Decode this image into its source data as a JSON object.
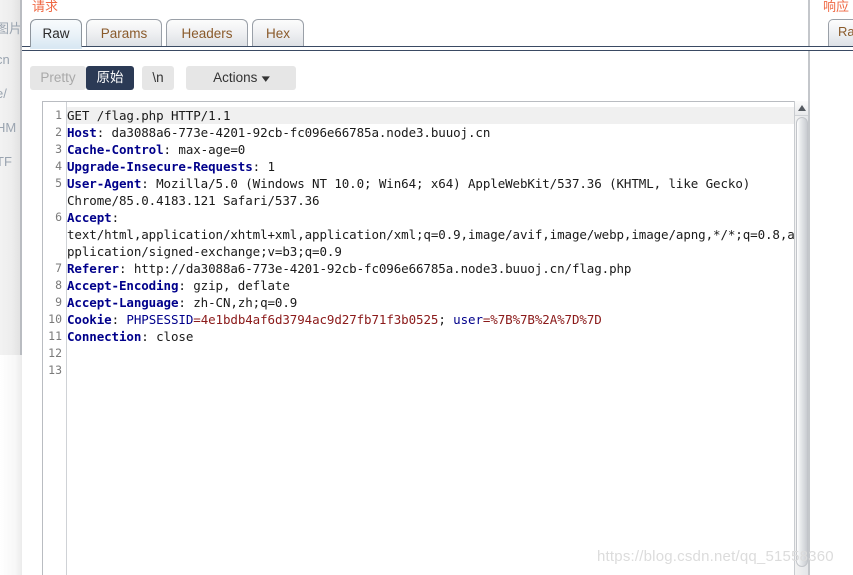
{
  "left_panel": {
    "clipped_text_fragments": [
      "图片",
      "cn",
      "e/",
      "HM",
      "TF"
    ]
  },
  "right_panel": {
    "section_label": "响应",
    "tab_label": "Ra"
  },
  "request_panel": {
    "section_label": "请求",
    "tabs": [
      {
        "label": "Raw",
        "active": true
      },
      {
        "label": "Params",
        "active": false
      },
      {
        "label": "Headers",
        "active": false
      },
      {
        "label": "Hex",
        "active": false
      }
    ],
    "toolbar": {
      "pretty_label": "Pretty",
      "raw_label": "原始",
      "newline_label": "\\n",
      "actions_label": "Actions",
      "actions_chevron": "chevron-down-icon"
    },
    "editor": {
      "line_numbers": [
        "1",
        "2",
        "3",
        "4",
        "5",
        "6",
        "7",
        "8",
        "9",
        "10",
        "11",
        "12",
        "13"
      ],
      "lines": [
        {
          "num": "1",
          "highlighted": true,
          "segments": [
            {
              "text": "GET /flag.php HTTP/1.1",
              "style": "plain"
            }
          ]
        },
        {
          "num": "2",
          "segments": [
            {
              "text": "Host",
              "style": "key"
            },
            {
              "text": ": da3088a6-773e-4201-92cb-fc096e66785a.node3.buuoj.cn",
              "style": "plain"
            }
          ]
        },
        {
          "num": "3",
          "segments": [
            {
              "text": "Cache-Control",
              "style": "key"
            },
            {
              "text": ": max-age=0",
              "style": "plain"
            }
          ]
        },
        {
          "num": "4",
          "segments": [
            {
              "text": "Upgrade-Insecure-Requests",
              "style": "key"
            },
            {
              "text": ": 1",
              "style": "plain"
            }
          ]
        },
        {
          "num": "5",
          "segments": [
            {
              "text": "User-Agent",
              "style": "key"
            },
            {
              "text": ": Mozilla/5.0 (Windows NT 10.0; Win64; x64) AppleWebKit/537.36 (KHTML, like Gecko)",
              "style": "plain"
            }
          ]
        },
        {
          "num": "",
          "wrapped": true,
          "segments": [
            {
              "text": "Chrome/85.0.4183.121 Safari/537.36",
              "style": "plain"
            }
          ]
        },
        {
          "num": "6",
          "segments": [
            {
              "text": "Accept",
              "style": "key"
            },
            {
              "text": ":",
              "style": "plain"
            }
          ]
        },
        {
          "num": "",
          "wrapped": true,
          "segments": [
            {
              "text": "text/html,application/xhtml+xml,application/xml;q=0.9,image/avif,image/webp,image/apng,*/*;q=0.8,a",
              "style": "plain"
            }
          ]
        },
        {
          "num": "",
          "wrapped": true,
          "segments": [
            {
              "text": "pplication/signed-exchange;v=b3;q=0.9",
              "style": "plain"
            }
          ]
        },
        {
          "num": "7",
          "segments": [
            {
              "text": "Referer",
              "style": "key"
            },
            {
              "text": ": http://da3088a6-773e-4201-92cb-fc096e66785a.node3.buuoj.cn/flag.php",
              "style": "plain"
            }
          ]
        },
        {
          "num": "8",
          "segments": [
            {
              "text": "Accept-Encoding",
              "style": "key"
            },
            {
              "text": ": gzip, deflate",
              "style": "plain"
            }
          ]
        },
        {
          "num": "9",
          "segments": [
            {
              "text": "Accept-Language",
              "style": "key"
            },
            {
              "text": ": zh-CN,zh;q=0.9",
              "style": "plain"
            }
          ]
        },
        {
          "num": "10",
          "segments": [
            {
              "text": "Cookie",
              "style": "key"
            },
            {
              "text": ": ",
              "style": "plain"
            },
            {
              "text": "PHPSESSID",
              "style": "blue"
            },
            {
              "text": "=4e1bdb4af6d3794ac9d27fb71f3b0525",
              "style": "red"
            },
            {
              "text": "; ",
              "style": "plain"
            },
            {
              "text": "user",
              "style": "blue"
            },
            {
              "text": "=%7B%7B%2A%7D%7D",
              "style": "red"
            }
          ]
        },
        {
          "num": "11",
          "segments": [
            {
              "text": "Connection",
              "style": "key"
            },
            {
              "text": ": close",
              "style": "plain"
            }
          ]
        },
        {
          "num": "12",
          "segments": []
        },
        {
          "num": "13",
          "segments": []
        }
      ]
    },
    "scrollbar": {
      "up_arrow": "triangle-up-icon"
    }
  },
  "watermark": {
    "text": "https://blog.csdn.net/qq_51558360"
  },
  "colors": {
    "tab_text": "#8a5a2b",
    "section_label": "#ef6a45",
    "header_key": "#00008b",
    "cookie_value": "#8b1a1a",
    "selected_button_bg": "#2b3a55"
  }
}
